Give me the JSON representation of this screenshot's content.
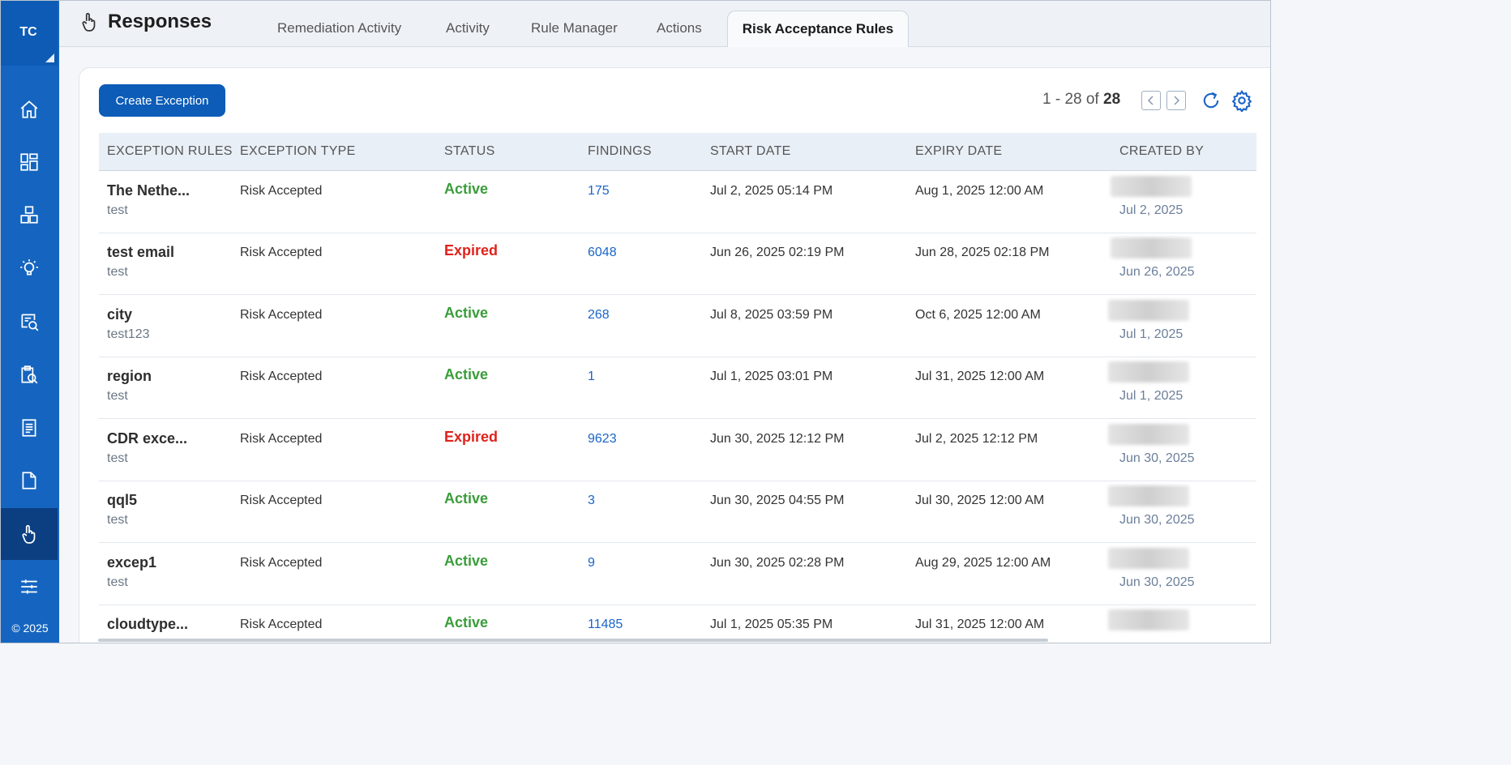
{
  "sidebar": {
    "initials": "TC",
    "copyright": "© 2025",
    "items": [
      {
        "icon": "home-icon"
      },
      {
        "icon": "dashboard-icon"
      },
      {
        "icon": "inventory-icon"
      },
      {
        "icon": "lightbulb-icon"
      },
      {
        "icon": "search-list-icon"
      },
      {
        "icon": "clipboard-search-icon"
      },
      {
        "icon": "report-icon"
      },
      {
        "icon": "document-icon"
      },
      {
        "icon": "hand-pointer-icon",
        "active": true
      },
      {
        "icon": "sliders-icon"
      }
    ]
  },
  "header": {
    "title": "Responses",
    "tabs": [
      {
        "label": "Remediation Activity"
      },
      {
        "label": "Activity"
      },
      {
        "label": "Rule Manager"
      },
      {
        "label": "Actions"
      },
      {
        "label": "Risk Acceptance Rules",
        "active": true
      }
    ]
  },
  "toolbar": {
    "create_label": "Create Exception",
    "range": "1 - 28 of",
    "total": "28"
  },
  "table": {
    "columns": [
      "EXCEPTION RULES",
      "EXCEPTION TYPE",
      "STATUS",
      "FINDINGS",
      "START DATE",
      "EXPIRY DATE",
      "CREATED BY"
    ],
    "rows": [
      {
        "name": "The Nethe...",
        "desc": "test",
        "type": "Risk Accepted",
        "status": "Active",
        "findings": "175",
        "start": "Jul 2, 2025 05:14 PM",
        "expiry": "Aug 1, 2025 12:00 AM",
        "created": "Jul 2, 2025"
      },
      {
        "name": "test email",
        "desc": "test",
        "type": "Risk Accepted",
        "status": "Expired",
        "findings": "6048",
        "start": "Jun 26, 2025 02:19 PM",
        "expiry": "Jun 28, 2025 02:18 PM",
        "created": "Jun 26, 2025"
      },
      {
        "name": "city",
        "desc": "test123",
        "type": "Risk Accepted",
        "status": "Active",
        "findings": "268",
        "start": "Jul 8, 2025 03:59 PM",
        "expiry": "Oct 6, 2025 12:00 AM",
        "created": "Jul 1, 2025"
      },
      {
        "name": "region",
        "desc": "test",
        "type": "Risk Accepted",
        "status": "Active",
        "findings": "1",
        "start": "Jul 1, 2025 03:01 PM",
        "expiry": "Jul 31, 2025 12:00 AM",
        "created": "Jul 1, 2025"
      },
      {
        "name": "CDR exce...",
        "desc": "test",
        "type": "Risk Accepted",
        "status": "Expired",
        "findings": "9623",
        "start": "Jun 30, 2025 12:12 PM",
        "expiry": "Jul 2, 2025 12:12 PM",
        "created": "Jun 30, 2025"
      },
      {
        "name": "qql5",
        "desc": "test",
        "type": "Risk Accepted",
        "status": "Active",
        "findings": "3",
        "start": "Jun 30, 2025 04:55 PM",
        "expiry": "Jul 30, 2025 12:00 AM",
        "created": "Jun 30, 2025"
      },
      {
        "name": "excep1",
        "desc": "test",
        "type": "Risk Accepted",
        "status": "Active",
        "findings": "9",
        "start": "Jun 30, 2025 02:28 PM",
        "expiry": "Aug 29, 2025 12:00 AM",
        "created": "Jun 30, 2025"
      },
      {
        "name": "cloudtype...",
        "desc": "",
        "type": "Risk Accepted",
        "status": "Active",
        "findings": "11485",
        "start": "Jul 1, 2025 05:35 PM",
        "expiry": "Jul 31, 2025 12:00 AM",
        "created": ""
      }
    ]
  },
  "colors": {
    "primary": "#0c5cb8",
    "sidebar": "#1565c0",
    "active": "#3a9d3a",
    "expired": "#e0221b",
    "link": "#1a64c8"
  }
}
